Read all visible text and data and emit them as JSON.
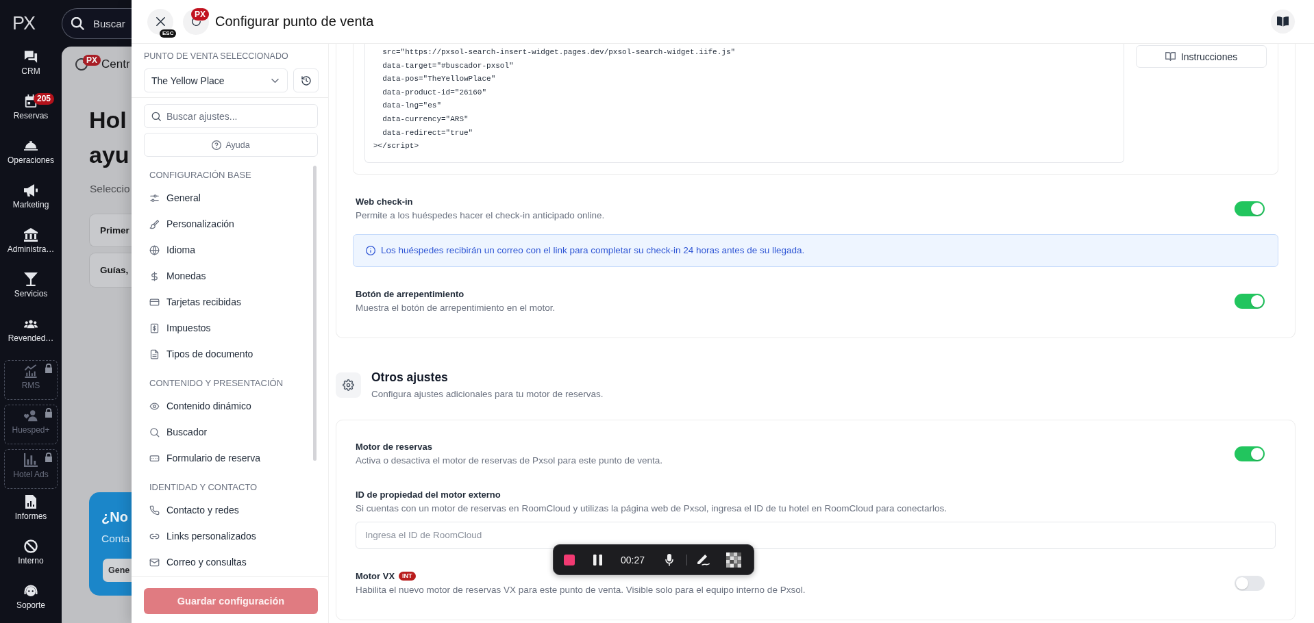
{
  "top_bar": {
    "logo": "PX",
    "search": {
      "placeholder": "Buscar"
    }
  },
  "nav": {
    "items": [
      {
        "label": "CRM",
        "locked": false
      },
      {
        "label": "Reservas",
        "badge": "205",
        "locked": false
      },
      {
        "label": "Operaciones",
        "locked": false
      },
      {
        "label": "Marketing",
        "locked": false
      },
      {
        "label": "Administra…",
        "locked": false
      },
      {
        "label": "Servicios",
        "locked": false
      },
      {
        "label": "Revended…",
        "locked": false
      },
      {
        "label": "RMS",
        "locked": true
      },
      {
        "label": "Huesped+",
        "locked": true
      },
      {
        "label": "Hotel Ads",
        "locked": true
      },
      {
        "label": "Informes",
        "locked": false
      },
      {
        "label": "Interno",
        "locked": false
      },
      {
        "label": "Soporte",
        "locked": false
      }
    ]
  },
  "background_page": {
    "header": {
      "badge": "PX",
      "title": "Centr"
    },
    "heading_lines": [
      "Hol",
      "ayu"
    ],
    "subtitle": "Seleccio",
    "cards": [
      {
        "title": "Primer"
      },
      {
        "title": "Guías,"
      }
    ],
    "promo": {
      "title": "¿No",
      "text": "Conta",
      "button": "Gene"
    }
  },
  "drawer": {
    "header": {
      "close_hint": "ESC",
      "refresh_badge": "PX",
      "title": "Configurar punto de venta"
    },
    "sidebar": {
      "pos_label": "PUNTO DE VENTA SELECCIONADO",
      "pos_select": {
        "value": "The Yellow Place"
      },
      "search": {
        "placeholder": "Buscar ajustes..."
      },
      "help_button": "Ayuda",
      "sections": [
        {
          "title": "CONFIGURACIÓN BASE",
          "items": [
            {
              "label": "General",
              "selected": false
            },
            {
              "label": "Personalización",
              "selected": false
            },
            {
              "label": "Idioma",
              "selected": false
            },
            {
              "label": "Monedas",
              "selected": false
            },
            {
              "label": "Tarjetas recibidas",
              "selected": false
            },
            {
              "label": "Impuestos",
              "selected": false
            },
            {
              "label": "Tipos de documento",
              "selected": false
            }
          ]
        },
        {
          "title": "CONTENIDO Y PRESENTACIÓN",
          "items": [
            {
              "label": "Contenido dinámico",
              "selected": false
            },
            {
              "label": "Buscador",
              "selected": false
            },
            {
              "label": "Formulario de reserva",
              "selected": false
            }
          ]
        },
        {
          "title": "IDENTIDAD Y CONTACTO",
          "items": [
            {
              "label": "Contacto y redes",
              "selected": false
            },
            {
              "label": "Links personalizados",
              "selected": false
            },
            {
              "label": "Correo y consultas",
              "selected": false
            }
          ]
        }
      ],
      "save_button": {
        "label": "Guardar configuración",
        "disabled": true
      }
    },
    "content": {
      "widget_card": {
        "code": "  src=\"https://pxsol-search-insert-widget.pages.dev/pxsol-search-widget.iife.js\"\n  data-target=\"#buscador-pxsol\"\n  data-pos=\"TheYellowPlace\"\n  data-product-id=\"26160\"\n  data-lng=\"es\"\n  data-currency=\"ARS\"\n  data-redirect=\"true\"\n></script>",
        "instructions_button": "Instrucciones",
        "settings": [
          {
            "kind": "toggle",
            "label": "Web check-in",
            "description": "Permite a los huéspedes hacer el check-in anticipado online.",
            "on": true
          },
          {
            "kind": "alert",
            "text": "Los huéspedes recibirán un correo con el link para completar su check-in 24 horas antes de su llegada."
          },
          {
            "kind": "toggle",
            "label": "Botón de arrepentimiento",
            "description": "Muestra el botón de arrepentimiento en el motor.",
            "on": true
          }
        ]
      },
      "sections": [
        {
          "title": "Otros ajustes",
          "description": "Configura ajustes adicionales para tu motor de reservas.",
          "settings": [
            {
              "kind": "toggle",
              "label": "Motor de reservas",
              "description": "Activa o desactiva el motor de reservas de Pxsol para este punto de venta.",
              "on": true
            },
            {
              "kind": "input",
              "label": "ID de propiedad del motor externo",
              "description": "Si cuentas con un motor de reservas en RoomCloud y utilizas la página web de Pxsol, ingresa el ID de tu hotel en RoomCloud para conectarlos.",
              "placeholder": "Ingresa el ID de RoomCloud"
            },
            {
              "kind": "toggle",
              "label": "Motor VX",
              "badge": "INT",
              "description": "Habilita el nuevo motor de reservas VX para este punto de venta. Visible solo para el equipo interno de Pxsol.",
              "on": false
            }
          ]
        }
      ]
    }
  },
  "recording_toolbar": {
    "time": "00:27"
  }
}
